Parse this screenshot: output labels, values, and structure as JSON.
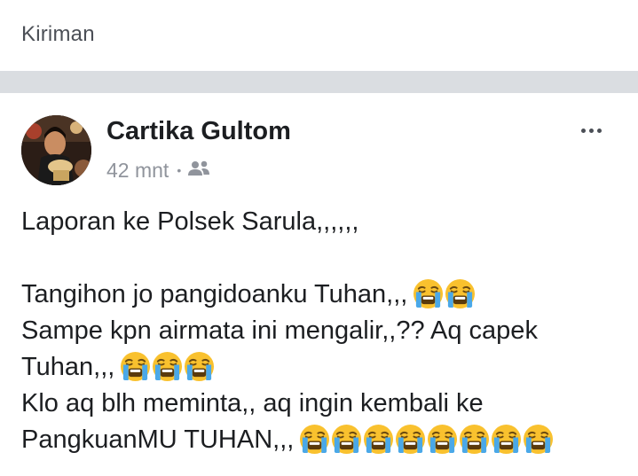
{
  "section": {
    "title": "Kiriman"
  },
  "post": {
    "author": "Cartika Gultom",
    "time": "42 mnt",
    "audience_icon": "friends-icon",
    "more_icon": "more-options-icon",
    "emoji_name": "loudly-crying-face-emoji",
    "lines": [
      {
        "text": "Laporan ke Polsek Sarula,,,,,,",
        "emoji_count": 0
      },
      {
        "text": "",
        "emoji_count": 0
      },
      {
        "text": "Tangihon jo pangidoanku Tuhan,,,",
        "emoji_count": 2
      },
      {
        "text": "Sampe kpn airmata ini mengalir,,?? Aq capek",
        "emoji_count": 0
      },
      {
        "text": "Tuhan,,,",
        "emoji_count": 3
      },
      {
        "text": "Klo aq blh meminta,, aq ingin kembali ke",
        "emoji_count": 0
      },
      {
        "text": "PangkuanMU TUHAN,,,",
        "emoji_count": 8
      }
    ]
  },
  "colors": {
    "band": "#dadde1",
    "text": "#1c1e21",
    "meta": "#90949c",
    "emoji_face": "#f9c12e",
    "emoji_tear": "#4aa8e8"
  }
}
